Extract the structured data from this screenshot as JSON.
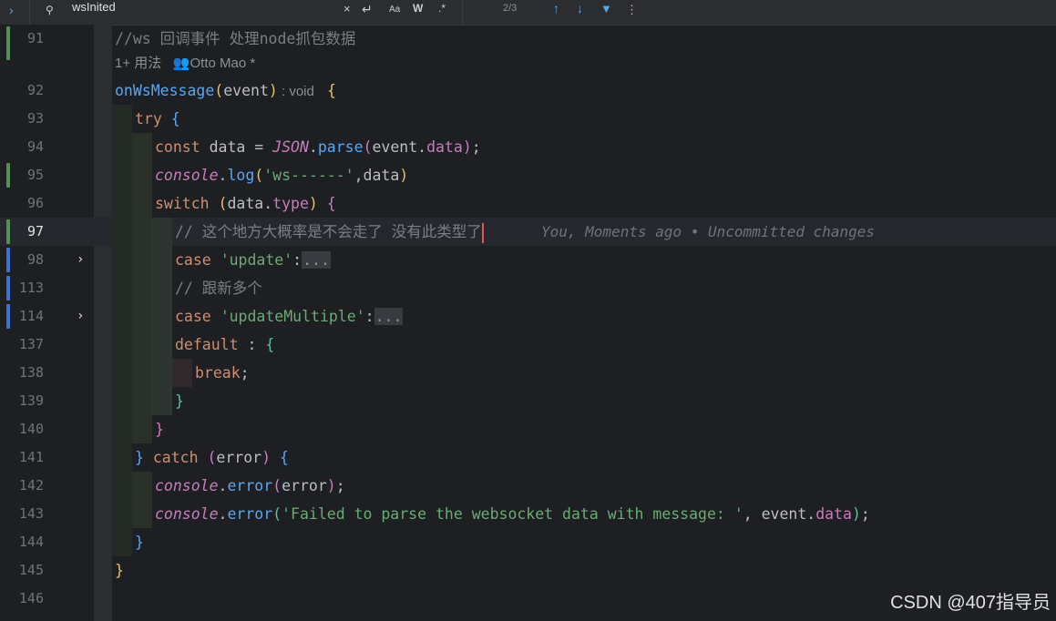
{
  "search": {
    "query": "wsInited",
    "counter": "2/3",
    "match_case_label": "Aa",
    "words_label": "W",
    "regex_label": ".*"
  },
  "icons": {
    "expand": "chevron-right-icon",
    "search": "search-history-icon",
    "clear": "close-icon",
    "newline": "enter-icon",
    "prev": "arrow-up-icon",
    "next": "arrow-down-icon",
    "filter": "filter-icon",
    "more": "more-vert-icon"
  },
  "hints": {
    "usages": "1+ 用法",
    "author": "Otto Mao *"
  },
  "blame": "You, Moments ago • Uncommitted changes",
  "lines": {
    "l91": "91",
    "l92": "92",
    "l93": "93",
    "l94": "94",
    "l95": "95",
    "l96": "96",
    "l97": "97",
    "l98": "98",
    "l113": "113",
    "l114": "114",
    "l137": "137",
    "l138": "138",
    "l139": "139",
    "l140": "140",
    "l141": "141",
    "l142": "142",
    "l143": "143",
    "l144": "144",
    "l145": "145",
    "l146": "146"
  },
  "code": {
    "c91": "//ws 回调事件 处理node抓包数据",
    "c92_fn": "onWsMessage",
    "c92_param": "event",
    "c92_type": " : void ",
    "c93_kw": "try",
    "c94_kw": "const",
    "c94_var": " data = ",
    "c94_json": "JSON",
    "c94_fn": "parse",
    "c94_arg": "event",
    "c94_prop": "data",
    "c95_obj": "console",
    "c95_fn": "log",
    "c95_str": "'ws------'",
    "c95_arg": ",data",
    "c96_kw": "switch",
    "c96_obj": "data",
    "c96_prop": "type",
    "c97": "// 这个地方大概率是不会走了 没有此类型了",
    "c98_kw": "case",
    "c98_str": "'update'",
    "fold": "...",
    "c113": "// 跟新多个",
    "c114_kw": "case",
    "c114_str": "'updateMultiple'",
    "c137_kw": "default",
    "c138_kw": "break",
    "c141_kw": "catch",
    "c141_arg": "error",
    "c142_obj": "console",
    "c142_fn": "error",
    "c142_arg": "error",
    "c143_obj": "console",
    "c143_fn": "error",
    "c143_str": "'Failed to parse the websocket data with message: '",
    "c143_arg": ", event.",
    "c143_prop": "data"
  },
  "watermark": "CSDN @407指导员",
  "colors": {
    "background": "#1e1f22",
    "keyword": "#cf8e6d",
    "function": "#56a8f5",
    "string": "#6aab73",
    "comment": "#7a7e85",
    "vcs_added": "#549159",
    "vcs_modified": "#3d6fd6"
  }
}
